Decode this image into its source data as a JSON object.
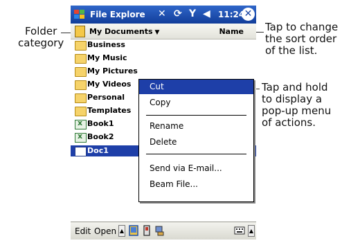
{
  "callouts": {
    "folder_category": [
      "Folder",
      "category"
    ],
    "sort_order": [
      "Tap to change",
      "the sort order",
      "of the list."
    ],
    "popup_menu": [
      "Tap and hold",
      "to display a",
      "pop-up menu",
      "of actions."
    ]
  },
  "titlebar": {
    "title": "File Explore",
    "time": "11:24",
    "icons": [
      "windows-start-icon",
      "connectivity-icon",
      "sync-icon",
      "signal-icon",
      "speaker-icon",
      "close-icon"
    ],
    "colors": {
      "bar": "#1b47a5",
      "text": "#ffffff"
    }
  },
  "subheader": {
    "folder": "My Documents",
    "sort": "Name"
  },
  "files": [
    {
      "name": "Business",
      "type": "folder"
    },
    {
      "name": "My Music",
      "type": "folder"
    },
    {
      "name": "My Pictures",
      "type": "folder"
    },
    {
      "name": "My Videos",
      "type": "folder"
    },
    {
      "name": "Personal",
      "type": "folder"
    },
    {
      "name": "Templates",
      "type": "folder"
    },
    {
      "name": "Book1",
      "type": "spreadsheet"
    },
    {
      "name": "Book2",
      "type": "spreadsheet"
    },
    {
      "name": "Doc1",
      "type": "document",
      "selected": true
    }
  ],
  "context_menu": {
    "items": [
      "Cut",
      "Copy",
      "Rename",
      "Delete",
      "Send via E-mail...",
      "Beam File..."
    ],
    "highlighted": "Cut",
    "highlight_color": "#1e3fa8"
  },
  "bottombar": {
    "edit": "Edit",
    "open": "Open"
  }
}
